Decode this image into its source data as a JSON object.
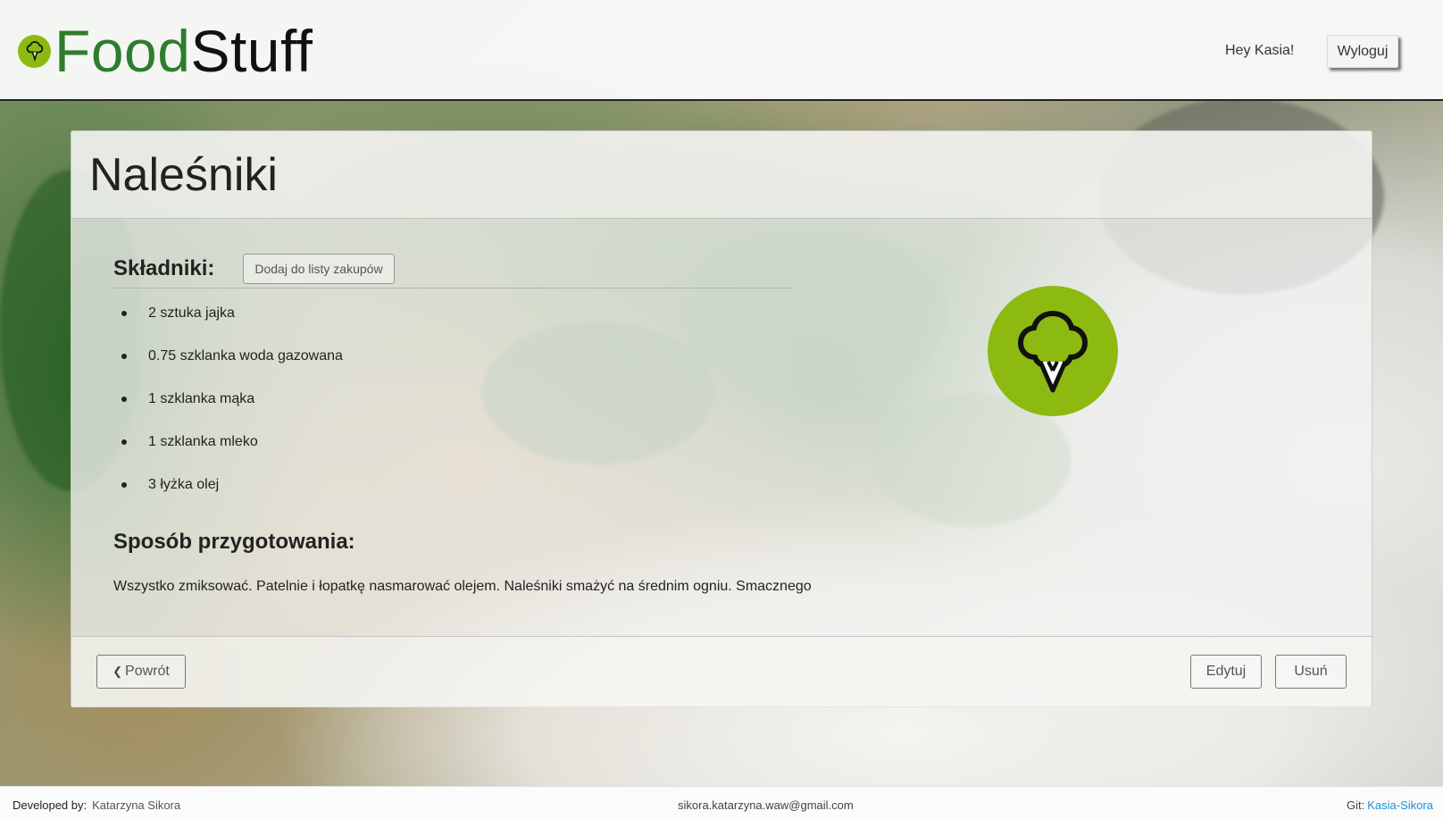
{
  "header": {
    "brand_food": "Food",
    "brand_stuff": "Stuff",
    "greeting": "Hey Kasia!",
    "logout_label": "Wyloguj"
  },
  "recipe": {
    "title": "Naleśniki",
    "ingredients_title": "Składniki:",
    "add_to_list_label": "Dodaj do listy zakupów",
    "ingredients": [
      "2 sztuka jajka",
      "0.75 szklanka woda gazowana",
      "1 szklanka mąka",
      "1 szklanka mleko",
      "3 łyżka olej"
    ],
    "prep_title": "Sposób przygotowania:",
    "prep_text": "Wszystko zmiksować. Patelnie i łopatkę nasmarować olejem. Naleśniki smażyć na średnim ogniu. Smacznego",
    "back_label": "Powrót",
    "edit_label": "Edytuj",
    "delete_label": "Usuń",
    "icon": "broccoli-icon"
  },
  "footer": {
    "dev_label": "Developed by:",
    "dev_name": "Katarzyna Sikora",
    "email": "sikora.katarzyna.waw@gmail.com",
    "git_label": "Git:",
    "git_link": "Kasia-Sikora"
  },
  "colors": {
    "brand_green": "#2e7d2e",
    "icon_green": "#8dba10",
    "link_blue": "#1a8fe0"
  }
}
